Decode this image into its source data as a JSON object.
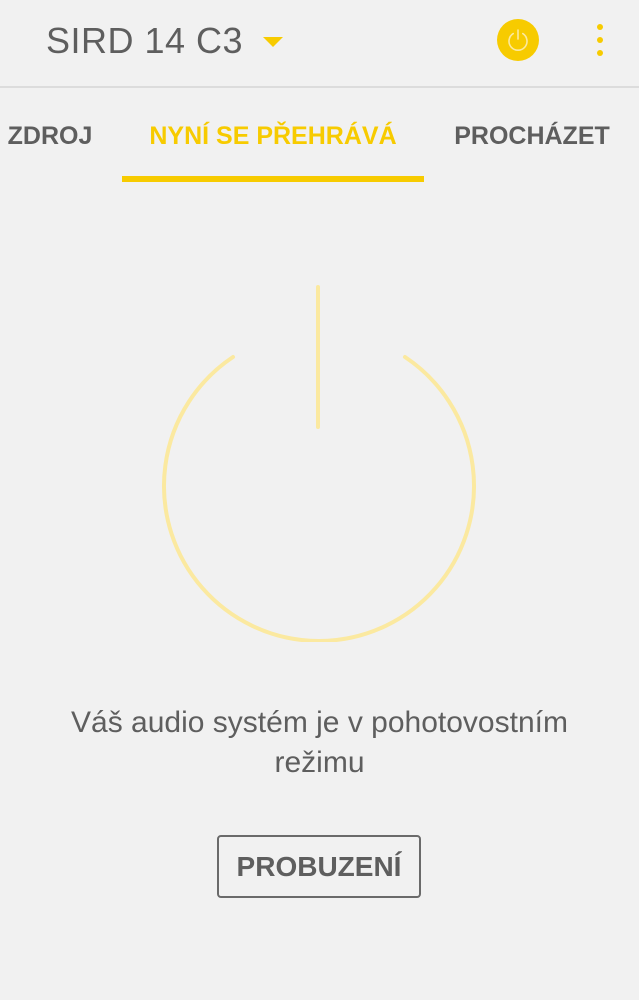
{
  "header": {
    "device_name": "SIRD 14 C3",
    "power_icon": "power-icon",
    "menu_icon": "more-vert-icon"
  },
  "tabs": [
    {
      "label": "ZDROJ"
    },
    {
      "label": "NYNÍ SE PŘEHRÁVÁ",
      "active": true
    },
    {
      "label": "PROCHÁZET"
    }
  ],
  "standby": {
    "icon": "standby-power-icon",
    "message_line1": "Váš audio systém je v pohotovostním",
    "message_line2": "režimu",
    "wake_label": "PROBUZENÍ"
  },
  "colors": {
    "accent": "#f7cb00",
    "accent_light": "#fbe9a0",
    "text": "#5e5e5e",
    "background": "#f1f1f1",
    "divider": "#dcdcdc"
  }
}
